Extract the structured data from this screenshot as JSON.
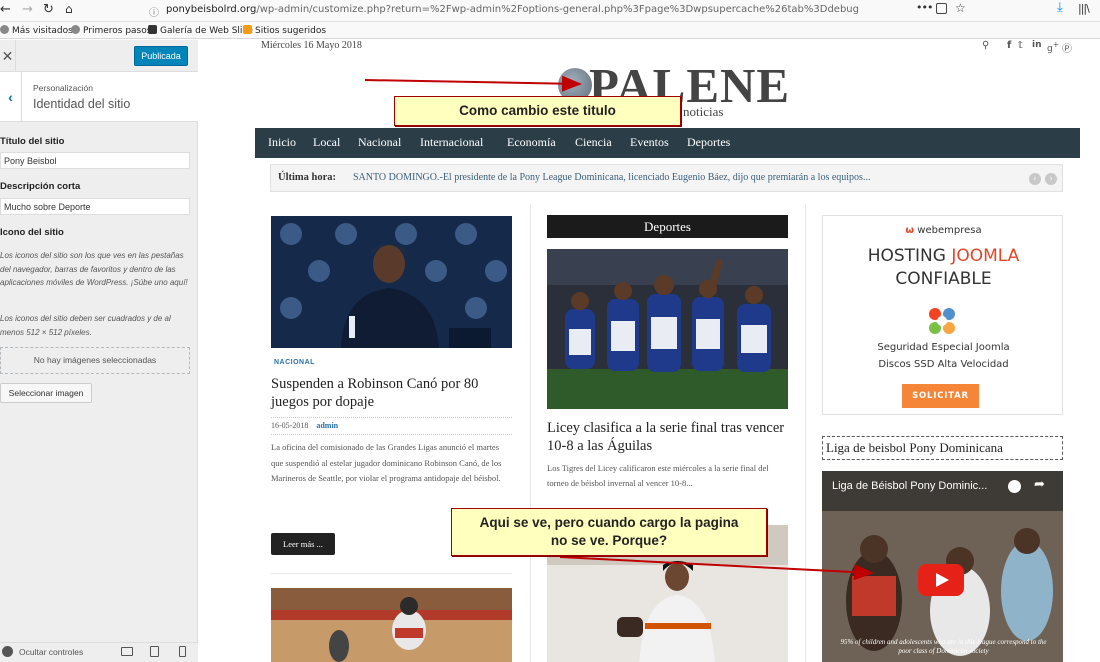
{
  "browser": {
    "url_host": "ponybeisbolrd.org",
    "url_path": "/wp-admin/customize.php?return=%2Fwp-admin%2Foptions-general.php%3Fpage%3Dwpsupercache%26tab%3Ddebug",
    "menu_dots": "•••",
    "bookmarks": [
      "Más visitados",
      "Primeros pasos",
      "Galería de Web Slice",
      "Sitios sugeridos"
    ]
  },
  "customizer": {
    "publish_label": "Publicada",
    "breadcrumb": "Personalización",
    "section_title": "Identidad del sitio",
    "site_title_label": "Título del sitio",
    "site_title_value": "Pony Beisbol",
    "tagline_label": "Descripción corta",
    "tagline_value": "Mucho sobre Deporte",
    "icon_label": "Icono del sitio",
    "icon_desc1": "Los iconos del sitio son los que ves en las pestañas del navegador, barras de favoritos y dentro de las aplicaciones móviles de WordPress. ¡Súbe uno aquí!",
    "icon_desc2": "Los iconos del sitio deben ser cuadrados y de al menos 512 × 512 píxeles.",
    "no_images": "No hay imágenes seleccionadas",
    "select_image": "Seleccionar imagen",
    "hide_controls": "Ocultar controles"
  },
  "site": {
    "date": "Miércoles 16 Mayo 2018",
    "logo_text": "PALENE",
    "logo_sub": "noticias",
    "nav": [
      "Inicio",
      "Local",
      "Nacional",
      "Internacional",
      "Economía",
      "Ciencia",
      "Eventos",
      "Deportes"
    ],
    "ticker_label": "Última hora:",
    "ticker_text": "SANTO DOMINGO.-El presidente de la Pony League Dominicana, licenciado Eugenio Báez, dijo que premiarán a los equipos...",
    "post1": {
      "category": "NACIONAL",
      "headline": "Suspenden a Robinson Canó por 80 juegos por dopaje",
      "date": "16-05-2018",
      "author": "admin",
      "excerpt": "La oficina del comisionado de las Grandes Ligas anunció el martes que suspendió al estelar jugador dominicano Robinson Canó, de los Marineros de Seattle, por violar el programa antidopaje del béisbol.",
      "read_more": "Leer más ..."
    },
    "deportes_heading": "Deportes",
    "post2": {
      "headline": "Licey clasifica a la serie final tras vencer 10-8 a las Águilas",
      "excerpt": "Los Tigres del Licey calificaron este miércoles a la serie final del torneo de béisbol invernal al vencer 10-8..."
    },
    "ad": {
      "brand": "webempresa",
      "line1_a": "HOSTING ",
      "line1_b": "JOOMLA",
      "line2": "CONFIABLE",
      "sec": "Seguridad Especial Joomla",
      "ssd": "Discos SSD Alta Velocidad",
      "cta": "SOLICITAR"
    },
    "widget_title": "Liga de beisbol Pony Dominicana",
    "video_title": "Liga de Béisbol Pony Dominic...",
    "video_caption": "95% of children and adolescents who are in this league correspond to the poor class of Dominican society"
  },
  "annotations": {
    "callout1": "Como cambio este titulo",
    "callout2_l1": "Aqui se ve, pero cuando cargo la pagina",
    "callout2_l2": "no se ve. Porque?"
  },
  "colors": {
    "nav_bg": "#2b3e48",
    "publish_blue": "#0085ba",
    "ad_orange": "#f58638",
    "callout_bg": "#ffffbe",
    "arrow_red": "#c00000"
  }
}
